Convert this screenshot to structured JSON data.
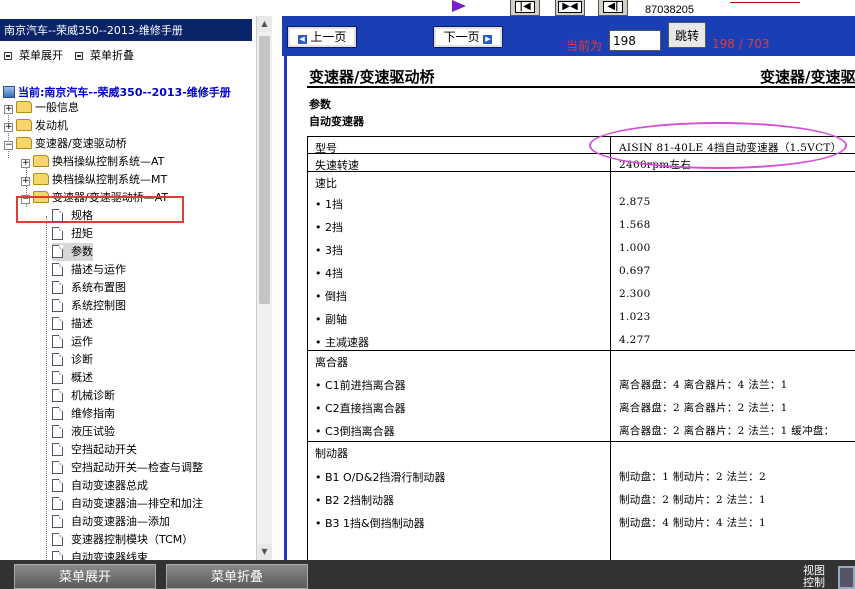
{
  "top": {
    "phone": "87038205"
  },
  "sidebar": {
    "title": "南京汽车--荣威350--2013-维修手册",
    "expand_label": "菜单展开",
    "collapse_label": "菜单折叠",
    "current": "当前:南京汽车--荣威350--2013-维修手册",
    "tree": [
      {
        "label": "一般信息"
      },
      {
        "label": "发动机"
      },
      {
        "label": "变速器/变速驱动桥"
      },
      {
        "label": "换档操纵控制系统—AT"
      },
      {
        "label": "换档操纵控制系统—MT"
      },
      {
        "label": "变速器/变速驱动桥—AT"
      }
    ],
    "docs": [
      "规格",
      "扭矩",
      "参数",
      "描述与运作",
      "系统布置图",
      "系统控制图",
      "描述",
      "运作",
      "诊断",
      "概述",
      "机械诊断",
      "维修指南",
      "液压试验",
      "空挡起动开关",
      "空挡起动开关—检查与调整",
      "自动变速器总成",
      "自动变速器油—排空和加注",
      "自动变速器油—添加",
      "变速器控制模块（TCM）",
      "自动变速器线束"
    ]
  },
  "nav": {
    "prev_label": "上一页",
    "next_label": "下一页",
    "current_label": "当前为",
    "page_value": "198",
    "jump_label": "跳转",
    "page_count": "198 / 703"
  },
  "document": {
    "title": "变速器/变速驱动桥",
    "title_right": "变速器/变速驱动桥",
    "section": "参数",
    "subsection": "自动变速器",
    "rows": [
      {
        "k": "型号",
        "v": "AISIN 81-40LE 4挡自动变速器（1.5VCT）"
      },
      {
        "k": "失速转速",
        "v": "2400rpm左右"
      },
      {
        "k": "速比",
        "v": ""
      },
      {
        "k": "• 1挡",
        "v": "2.875"
      },
      {
        "k": "• 2挡",
        "v": "1.568"
      },
      {
        "k": "• 3挡",
        "v": "1.000"
      },
      {
        "k": "• 4挡",
        "v": "0.697"
      },
      {
        "k": "• 倒挡",
        "v": "2.300"
      },
      {
        "k": "• 副轴",
        "v": "1.023"
      },
      {
        "k": "• 主减速器",
        "v": "4.277"
      },
      {
        "k": "离合器",
        "v": ""
      },
      {
        "k": "• C1前进挡离合器",
        "v": "离合器盘：4 离合器片：4 法兰：1"
      },
      {
        "k": "• C2直接挡离合器",
        "v": "离合器盘：2 离合器片：2 法兰：1"
      },
      {
        "k": "• C3倒挡离合器",
        "v": "离合器盘：2 离合器片：2 法兰：1 缓冲盘："
      },
      {
        "k": "制动器",
        "v": ""
      },
      {
        "k": "• B1 O/D&2挡滑行制动器",
        "v": "制动盘：1 制动片：2 法兰：2"
      },
      {
        "k": "• B2 2挡制动器",
        "v": "制动盘：2 制动片：2 法兰：1"
      },
      {
        "k": "• B3 1挡&倒挡制动器",
        "v": "制动盘：4 制动片：4 法兰：1"
      }
    ]
  },
  "bottom": {
    "expand_label": "菜单展开",
    "collapse_label": "菜单折叠",
    "view_control": "视图控制"
  }
}
